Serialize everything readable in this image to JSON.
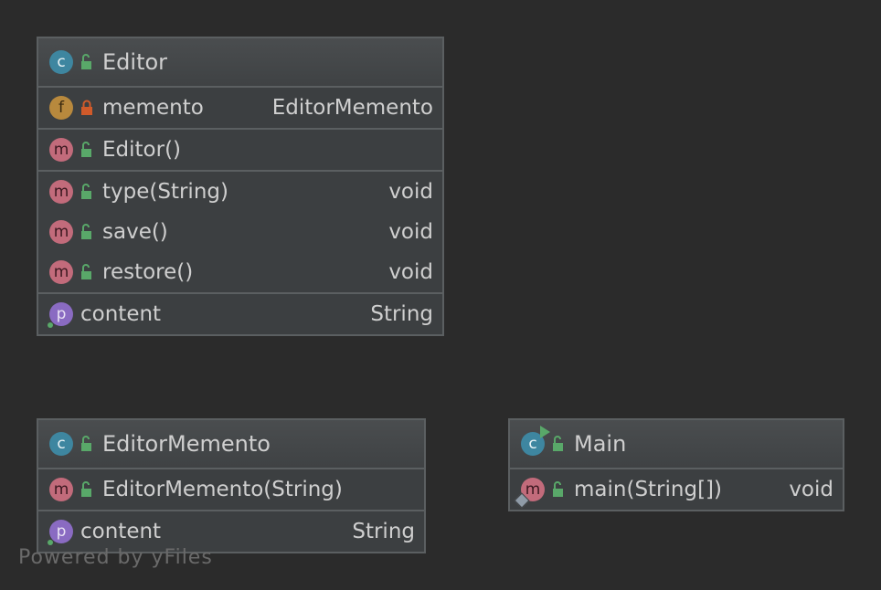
{
  "classes": {
    "editor": {
      "name": "Editor",
      "field": {
        "name": "memento",
        "type": "EditorMemento"
      },
      "constructor": {
        "name": "Editor()"
      },
      "methods": [
        {
          "name": "type(String)",
          "type": "void"
        },
        {
          "name": "save()",
          "type": "void"
        },
        {
          "name": "restore()",
          "type": "void"
        }
      ],
      "property": {
        "name": "content",
        "type": "String"
      }
    },
    "editor_memento": {
      "name": "EditorMemento",
      "constructor": {
        "name": "EditorMemento(String)"
      },
      "property": {
        "name": "content",
        "type": "String"
      }
    },
    "main": {
      "name": "Main",
      "method": {
        "name": "main(String[])",
        "type": "void"
      }
    }
  },
  "badges": {
    "class": "c",
    "field": "f",
    "method": "m",
    "property": "p"
  },
  "colors": {
    "background": "#2b2b2b",
    "class_badge": "#3e86a0",
    "field_badge": "#b8893d",
    "method_badge": "#c26b7b",
    "property_badge": "#8a6bc2",
    "public_lock": "#59a869",
    "private_lock": "#d05a2a"
  },
  "footer": "Powered by yFiles"
}
